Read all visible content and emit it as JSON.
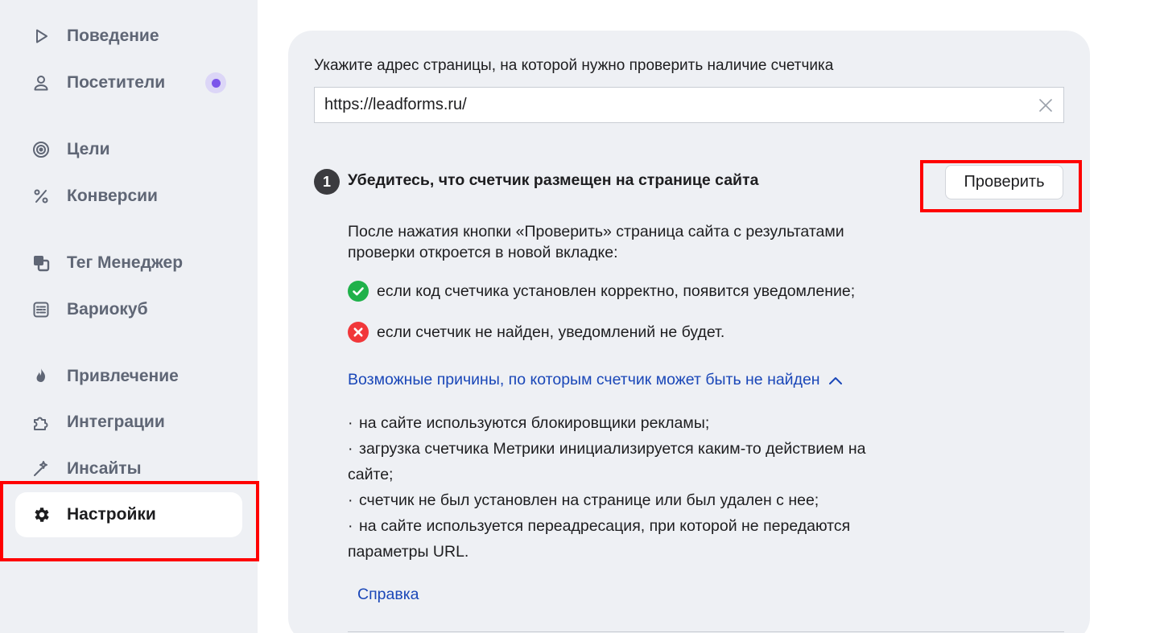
{
  "sidebar": {
    "items": [
      {
        "label": "Поведение",
        "icon": "play-icon"
      },
      {
        "label": "Посетители",
        "icon": "user-icon",
        "badge": "new-dot"
      },
      {
        "label": "Цели",
        "icon": "target-icon"
      },
      {
        "label": "Конверсии",
        "icon": "percent-icon"
      },
      {
        "label": "Тег Менеджер",
        "icon": "tag-manager-icon"
      },
      {
        "label": "Вариокуб",
        "icon": "variocube-icon"
      },
      {
        "label": "Привлечение",
        "icon": "flame-icon"
      },
      {
        "label": "Интеграции",
        "icon": "puzzle-icon"
      },
      {
        "label": "Инсайты",
        "icon": "sparkle-wand-icon"
      },
      {
        "label": "Настройки",
        "icon": "gear-icon",
        "active": true
      }
    ],
    "badge_color": "#7b55ea"
  },
  "main": {
    "url_prompt": "Укажите адрес страницы, на которой нужно проверить наличие счетчика",
    "url_value": "https://leadforms.ru/",
    "step": {
      "number": "1",
      "title": "Убедитесь, что счетчик размещен на странице сайта",
      "button_label": "Проверить"
    },
    "description_lines": [
      "После нажатия кнопки «Проверить» страница сайта с результатами",
      "проверки откроется в новой вкладке:"
    ],
    "status_ok": "если код счетчика установлен корректно, появится уведомление;",
    "status_fail": "если счетчик не найден, уведомлений не будет.",
    "reasons_link": "Возможные причины, по которым счетчик может быть не найден",
    "reasons_lines": [
      {
        "bullet": true,
        "text": "на сайте используются блокировщики рекламы;"
      },
      {
        "bullet": true,
        "text": "загрузка счетчика Метрики инициализируется каким-то действием на"
      },
      {
        "bullet": false,
        "text": "сайте;"
      },
      {
        "bullet": true,
        "text": "счетчик не был установлен на странице или был удален с нее;"
      },
      {
        "bullet": true,
        "text": "на сайте используется переадресация, при которой не передаются"
      },
      {
        "bullet": false,
        "text": "параметры URL."
      }
    ],
    "help_link": "Справка"
  },
  "colors": {
    "sidebar_bg": "#eef0f4",
    "link": "#1a47b8",
    "ok_green": "#1fb14a",
    "fail_red": "#f1373a",
    "annotation_red": "#ff0000"
  }
}
